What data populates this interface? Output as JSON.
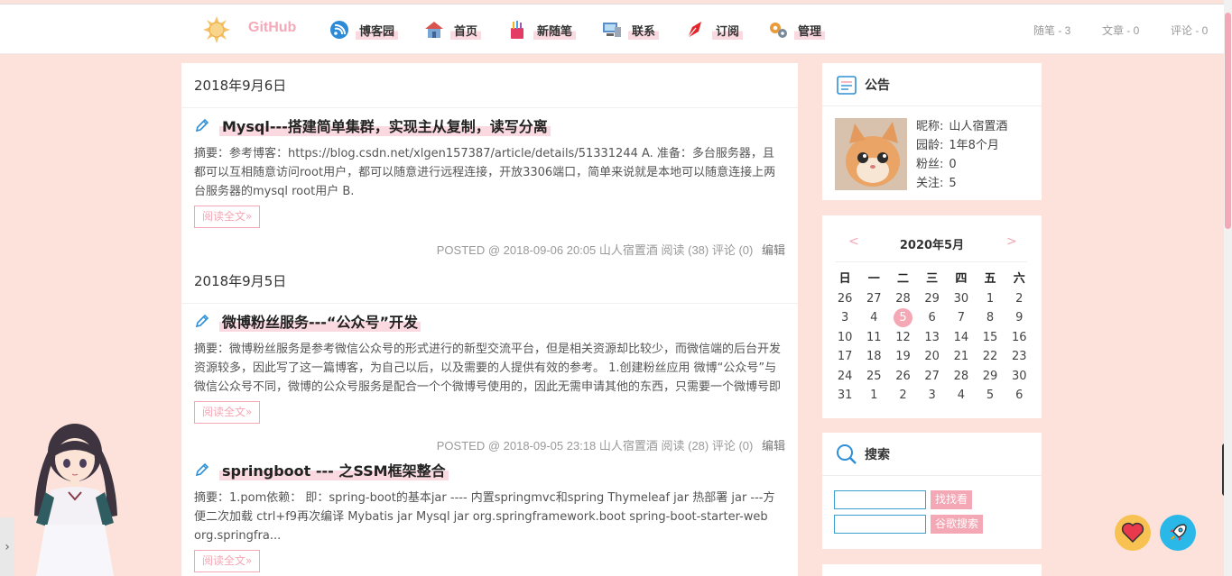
{
  "brand": {
    "name": "GitHub"
  },
  "nav": [
    {
      "label": "博客园",
      "icon": "wifi-badge-icon"
    },
    {
      "label": "首页",
      "icon": "house-icon"
    },
    {
      "label": "新随笔",
      "icon": "pencil-cup-icon"
    },
    {
      "label": "联系",
      "icon": "computer-icon"
    },
    {
      "label": "订阅",
      "icon": "pen-nib-icon"
    },
    {
      "label": "管理",
      "icon": "gears-icon"
    }
  ],
  "stats": {
    "posts": "随笔 - 3",
    "articles": "文章 - 0",
    "comments": "评论 - 0"
  },
  "days": [
    {
      "date": "2018年9月6日",
      "post": {
        "title": "Mysql---搭建简单集群，实现主从复制，读写分离",
        "summary": "摘要：参考博客：https://blog.csdn.net/xlgen157387/article/details/51331244 A. 准备：多台服务器，且都可以互相随意访问root用户，都可以随意进行远程连接，开放3306端口，简单来说就是本地可以随意连接上两台服务器的mysql root用户 B.",
        "read_more": "阅读全文»",
        "meta": "POSTED @ 2018-09-06 20:05 山人宿置酒 阅读 (38) 评论 (0)",
        "edit": "编辑"
      }
    },
    {
      "date": "2018年9月5日",
      "post": {
        "title": "微博粉丝服务---“公众号”开发",
        "summary": "摘要：微博粉丝服务是参考微信公众号的形式进行的新型交流平台，但是相关资源却比较少，而微信端的后台开发资源较多，因此写了这一篇博客，为自己以后，以及需要的人提供有效的参考。 1.创建粉丝应用 微博“公众号”与微信公众号不同，微博的公众号服务是配合一个个微博号使用的，因此无需申请其他的东西，只需要一个微博号即",
        "read_more": "阅读全文»",
        "meta": "POSTED @ 2018-09-05 23:18 山人宿置酒 阅读 (28) 评论 (0)",
        "edit": "编辑"
      }
    }
  ],
  "post3": {
    "title": "springboot --- 之SSM框架整合",
    "summary": "摘要：1.pom依赖： 即：spring-boot的基本jar ---- 内置springmvc和spring Thymeleaf jar 热部署 jar ---方便二次加载 ctrl+f9再次编译 Mybatis jar Mysql jar org.springframework.boot spring-boot-starter-web org.springfra...",
    "read_more": "阅读全文»"
  },
  "notice": {
    "title": "公告",
    "nickname_label": "昵称:",
    "nickname": "山人宿置酒",
    "age_label": "园龄:",
    "age": "1年8个月",
    "fans_label": "粉丝:",
    "fans": "0",
    "follow_label": "关注:",
    "follow": "5"
  },
  "calendar": {
    "title": "2020年5月",
    "prev": "<",
    "next": ">",
    "weekdays": [
      "日",
      "一",
      "二",
      "三",
      "四",
      "五",
      "六"
    ],
    "weeks": [
      [
        "26",
        "27",
        "28",
        "29",
        "30",
        "1",
        "2"
      ],
      [
        "3",
        "4",
        "5",
        "6",
        "7",
        "8",
        "9"
      ],
      [
        "10",
        "11",
        "12",
        "13",
        "14",
        "15",
        "16"
      ],
      [
        "17",
        "18",
        "19",
        "20",
        "21",
        "22",
        "23"
      ],
      [
        "24",
        "25",
        "26",
        "27",
        "28",
        "29",
        "30"
      ],
      [
        "31",
        "1",
        "2",
        "3",
        "4",
        "5",
        "6"
      ]
    ],
    "today": "5"
  },
  "search": {
    "title": "搜索",
    "btn1": "找找看",
    "btn2": "谷歌搜索"
  },
  "side_tab": "›",
  "colors": {
    "accent": "#f4a7b4",
    "background": "#fde2dc",
    "link_blue": "#3aa0cf"
  }
}
